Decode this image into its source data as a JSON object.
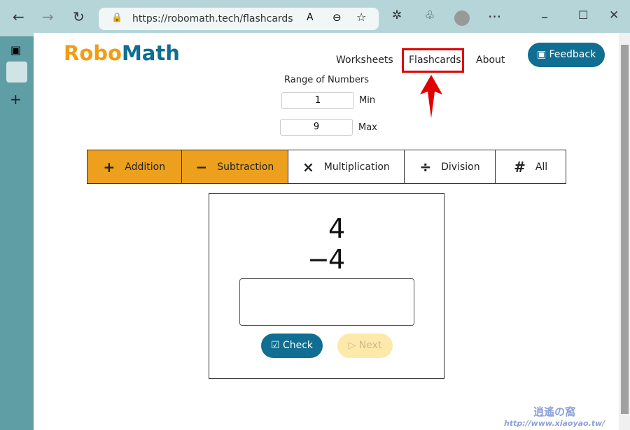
{
  "browser": {
    "url": "https://robomath.tech/flashcards"
  },
  "site": {
    "logo_a": "Robo",
    "logo_b": "Math",
    "nav": [
      "Worksheets",
      "Flashcards",
      "About"
    ],
    "feedback": "Feedback"
  },
  "range": {
    "title": "Range of Numbers",
    "min_value": "1",
    "min_label": "Min",
    "max_value": "9",
    "max_label": "Max"
  },
  "operations": [
    {
      "icon": "+",
      "label": "Addition",
      "active": true
    },
    {
      "icon": "−",
      "label": "Subtraction",
      "active": true
    },
    {
      "icon": "×",
      "label": "Multiplication",
      "active": false
    },
    {
      "icon": "÷",
      "label": "Division",
      "active": false
    },
    {
      "icon": "#",
      "label": "All",
      "active": false
    }
  ],
  "card": {
    "top": "4",
    "operator": "−",
    "bottom": "4",
    "answer": "",
    "check": "Check",
    "next": "Next"
  },
  "watermark": {
    "title": "逍遙の窩",
    "url": "http://www.xiaoyao.tw/"
  },
  "colors": {
    "accent": "#0f6e91",
    "active_op": "#eda01d",
    "highlight": "#e00000"
  }
}
